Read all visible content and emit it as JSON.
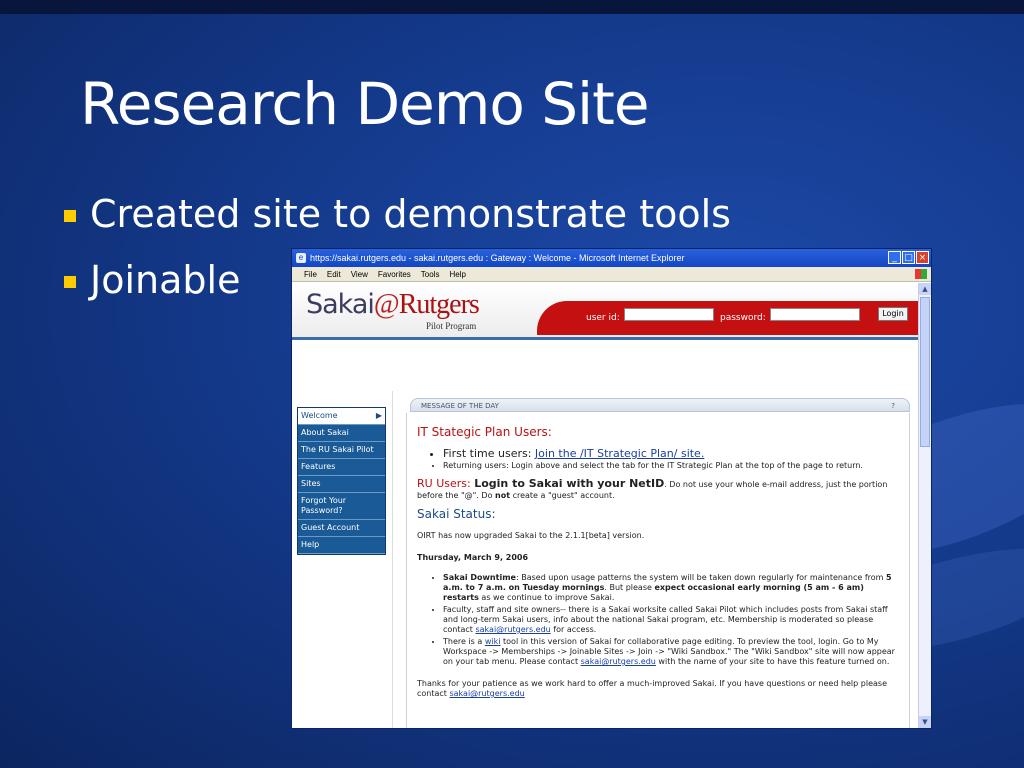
{
  "slide": {
    "title": "Research Demo Site",
    "bullets": [
      "Created site to demonstrate tools",
      "Joinable"
    ]
  },
  "browser": {
    "title": "https://sakai.rutgers.edu - sakai.rutgers.edu : Gateway : Welcome - Microsoft Internet Explorer",
    "menu": [
      "File",
      "Edit",
      "View",
      "Favorites",
      "Tools",
      "Help"
    ]
  },
  "header": {
    "logo_sakai": "Sakai",
    "logo_at": "@",
    "logo_rutgers": "Rutgers",
    "pilot": "Pilot Program",
    "userid_label": "user id:",
    "password_label": "password:",
    "login_button": "Login"
  },
  "nav": {
    "items": [
      "Welcome",
      "About Sakai",
      "The RU Sakai Pilot",
      "Features",
      "Sites",
      "Forgot Your Password?",
      "Guest Account",
      "Help"
    ]
  },
  "motd": {
    "title": "MESSAGE OF THE DAY",
    "help": "?",
    "it_heading": "IT Stategic Plan Users:",
    "first_time_prefix": "First time users: ",
    "first_time_link": "Join the /IT Strategic Plan/ site.",
    "returning": "Returning users: Login above and select the tab for the IT Strategic Plan at the top of the page to return.",
    "ru_heading": "RU Users:",
    "ru_bold": "Login to Sakai with your NetID",
    "ru_text1": ". Do not use your whole e-mail address, just the portion before the \"@\". Do ",
    "ru_not": "not",
    "ru_text2": " create a \"guest\" account.",
    "status_heading": "Sakai Status:",
    "upgrade": "OIRT has now upgraded Sakai to the 2.1.1[beta] version.",
    "date": "Thursday, March 9, 2006",
    "downtime_bold": "Sakai Downtime",
    "downtime_text1": ": Based upon usage patterns the system will be taken down regularly for maintenance from ",
    "downtime_bold2": "5 a.m. to 7 a.m. on Tuesday mornings",
    "downtime_text2": ". But please ",
    "downtime_bold3": "expect occasional early morning (5 am - 6 am) restarts",
    "downtime_text3": " as we continue to improve Sakai.",
    "faculty_text": "Faculty, staff and site owners-- there is a Sakai worksite called Sakai Pilot which includes posts from Sakai staff and long-term Sakai users, info about the national Sakai program, etc. Membership is moderated so please contact ",
    "email": "sakai@rutgers.edu",
    "faculty_end": " for access.",
    "wiki_prefix": "There is a ",
    "wiki_link": "wiki",
    "wiki_text": " tool in this version of Sakai for collaborative page editing. To preview the tool, login. Go to My Workspace -> Memberships -> Joinable Sites -> Join -> \"Wiki Sandbox.\" The \"Wiki Sandbox\" site will now appear on your tab menu. Please contact ",
    "wiki_end": " with the name of your site to have this feature turned on.",
    "thanks": "Thanks for your patience as we work hard to offer a much-improved Sakai. If you have questions or need help please contact "
  }
}
